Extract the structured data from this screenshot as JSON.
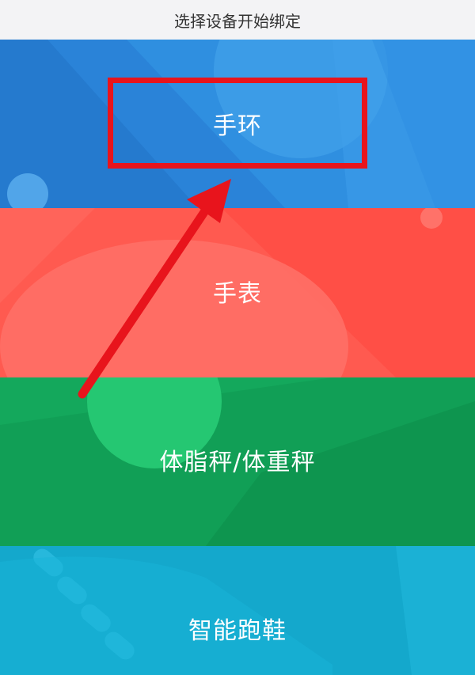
{
  "header": {
    "title": "选择设备开始绑定"
  },
  "devices": [
    {
      "label": "手环",
      "color": "#2f8fe0"
    },
    {
      "label": "手表",
      "color": "#ff5a50"
    },
    {
      "label": "体脂秤/体重秤",
      "color": "#14a85c"
    },
    {
      "label": "智能跑鞋",
      "color": "#15aed2"
    }
  ],
  "annotation": {
    "highlight_color": "#e8141c",
    "highlighted_item": "手环"
  }
}
